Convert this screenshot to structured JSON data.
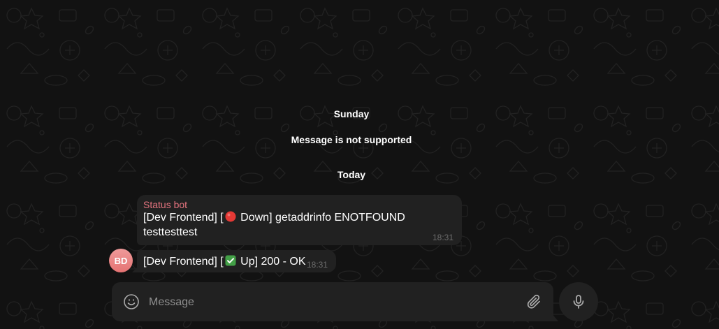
{
  "date_separators": {
    "sunday": "Sunday",
    "today": "Today"
  },
  "service_message": "Message is not supported",
  "messages": [
    {
      "sender": "Status bot",
      "text_prefix": "[Dev Frontend] [",
      "status_icon": "red-circle-icon",
      "text_status": " Down] getaddrinfo ENOTFOUND",
      "text_line2": "testtesttest",
      "time": "18:31"
    },
    {
      "text_prefix": "[Dev Frontend] [",
      "status_icon": "green-check-icon",
      "text_status": " Up] 200 - OK",
      "time": "18:31"
    }
  ],
  "avatar": {
    "initials": "BD",
    "color": "#e57373"
  },
  "composer": {
    "placeholder": "Message"
  },
  "colors": {
    "background": "#121212",
    "bubble": "#212121",
    "sender_name": "#e3737e",
    "time": "#6d6d6d",
    "red_status": "#e53935",
    "green_status": "#43a047"
  }
}
